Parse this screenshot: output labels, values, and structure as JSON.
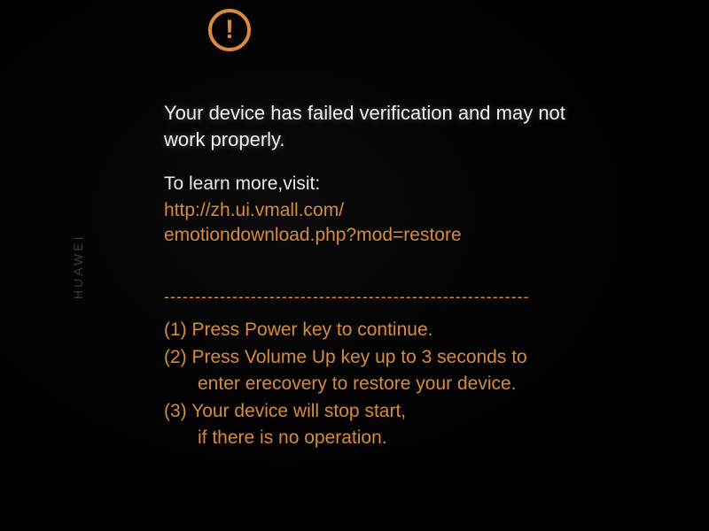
{
  "brand": "HUAWEI",
  "warning": {
    "symbol": "!",
    "message": "Your device has failed verification and may not work properly.",
    "learn_more_label": "To learn more,visit:",
    "url_line1": "http://zh.ui.vmall.com/",
    "url_line2": "emotiondownload.php?mod=restore"
  },
  "divider": "-----------------------------------------------------------",
  "instructions": {
    "item1": "(1) Press Power key to continue.",
    "item2": "(2) Press Volume Up key up to 3 seconds to",
    "item2_cont": "enter erecovery to restore your device.",
    "item3": "(3) Your device will stop start,",
    "item3_cont": "if there is no operation."
  },
  "colors": {
    "accent": "#d88b3a",
    "text_primary": "#f0f0f0",
    "background": "#000000"
  }
}
